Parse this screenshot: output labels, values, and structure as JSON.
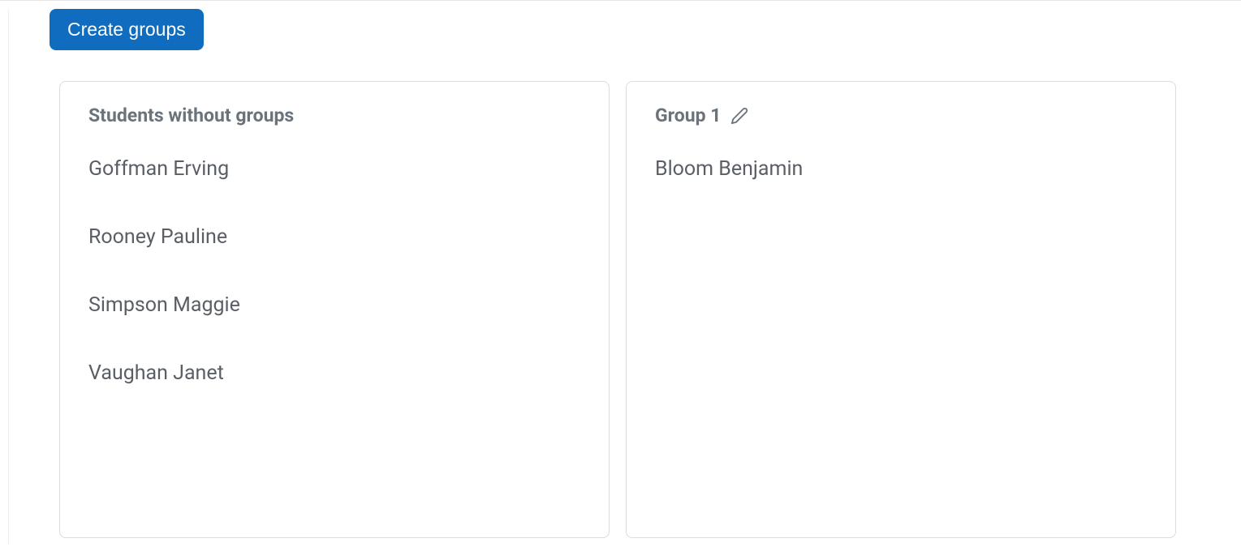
{
  "toolbar": {
    "create_groups_label": "Create groups"
  },
  "unassigned": {
    "title": "Students without groups",
    "students": [
      "Goffman Erving",
      "Rooney Pauline",
      "Simpson Maggie",
      "Vaughan Janet"
    ]
  },
  "groups": [
    {
      "name": "Group 1",
      "students": [
        "Bloom Benjamin"
      ]
    }
  ]
}
